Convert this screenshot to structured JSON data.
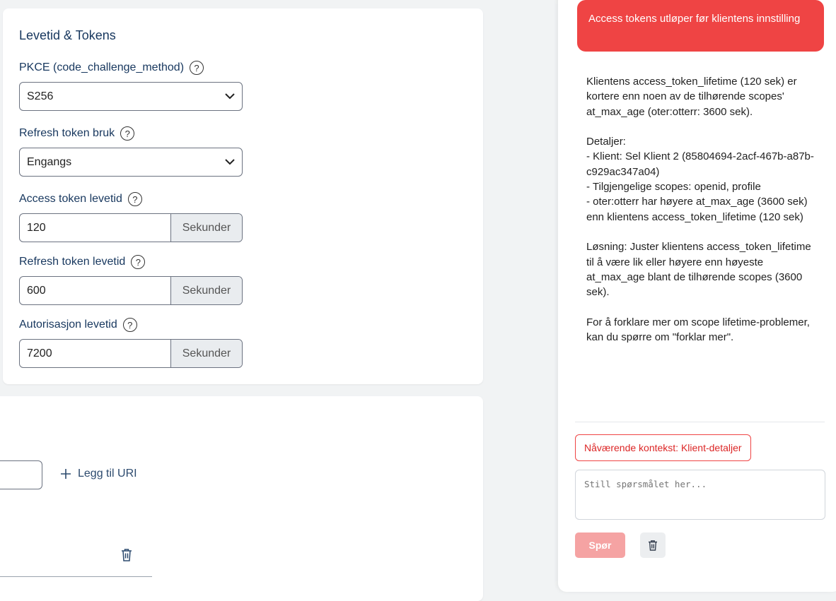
{
  "tokens_section": {
    "title": "Levetid & Tokens",
    "pkce": {
      "label": "PKCE (code_challenge_method)",
      "value": "S256"
    },
    "refresh_usage": {
      "label": "Refresh token bruk",
      "value": "Engangs"
    },
    "access_lifetime": {
      "label": "Access token levetid",
      "value": "120",
      "unit": "Sekunder"
    },
    "refresh_lifetime": {
      "label": "Refresh token levetid",
      "value": "600",
      "unit": "Sekunder"
    },
    "auth_lifetime": {
      "label": "Autorisasjon levetid",
      "value": "7200",
      "unit": "Sekunder"
    },
    "help_symbol": "?"
  },
  "uri_section": {
    "add_uri_label": "Legg til URI"
  },
  "assistant": {
    "alert_title": "Access tokens utløper før klientens innstilling",
    "message": "Klientens access_token_lifetime (120 sek) er kortere enn noen av de tilhørende scopes' at_max_age (oter:otterr: 3600 sek).\n\nDetaljer:\n- Klient: Sel Klient 2 (85804694-2acf-467b-a87b-c929ac347a04)\n- Tilgjengelige scopes: openid, profile\n- oter:otterr har høyere at_max_age (3600 sek) enn klientens access_token_lifetime (120 sek)\n\nLøsning: Juster klientens access_token_lifetime til å være lik eller høyere enn høyeste at_max_age blant de tilhørende scopes (3600 sek).\n\nFor å forklare mer om scope lifetime-problemer, kan du spørre om \"forklar mer\".",
    "context_label": "Nåværende kontekst: Klient-detaljer",
    "question_placeholder": "Still spørsmålet her...",
    "ask_label": "Spør"
  },
  "colors": {
    "alert": "#ef4444",
    "title": "#17375e",
    "ask_button": "#f5a3a3"
  }
}
